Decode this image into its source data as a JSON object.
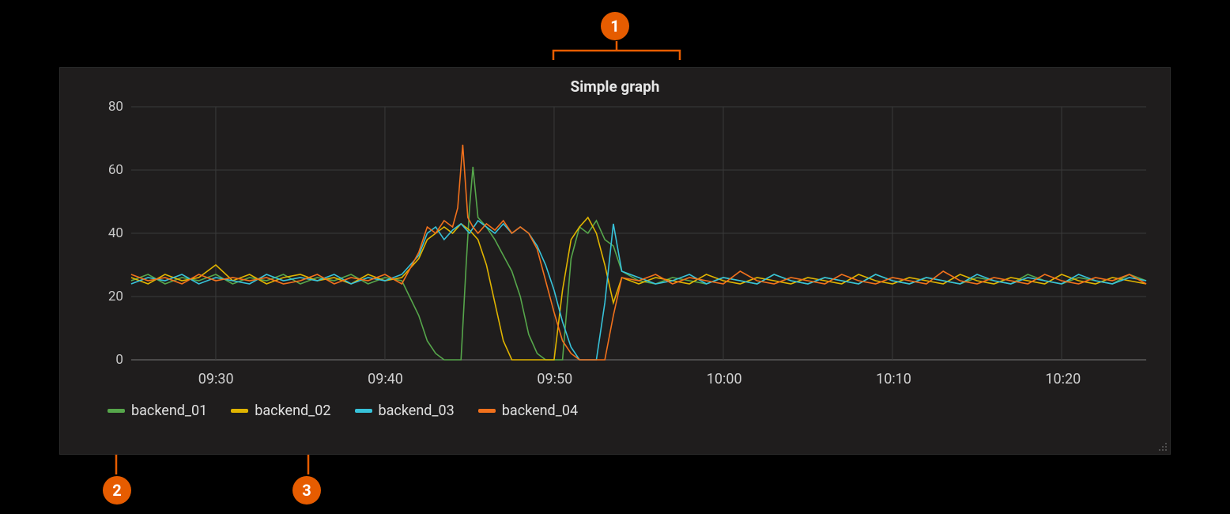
{
  "callouts": {
    "c1": "1",
    "c2": "2",
    "c3": "3"
  },
  "panel": {
    "title": "Simple graph"
  },
  "legend": [
    {
      "name": "backend_01",
      "color": "#56a64b"
    },
    {
      "name": "backend_02",
      "color": "#e0b400"
    },
    {
      "name": "backend_03",
      "color": "#37c2d9"
    },
    {
      "name": "backend_04",
      "color": "#f2711c"
    }
  ],
  "chart_data": {
    "type": "line",
    "title": "Simple graph",
    "xlabel": "",
    "ylabel": "",
    "ylim": [
      0,
      80
    ],
    "y_ticks": [
      0,
      20,
      40,
      60,
      80
    ],
    "x_ticks": [
      "09:30",
      "09:40",
      "09:50",
      "10:00",
      "10:10",
      "10:20"
    ],
    "x_range_minutes": [
      25,
      85
    ],
    "series": [
      {
        "name": "backend_01",
        "color": "#56a64b",
        "values": [
          [
            25,
            25
          ],
          [
            26,
            27
          ],
          [
            27,
            24
          ],
          [
            28,
            26
          ],
          [
            29,
            25
          ],
          [
            30,
            27
          ],
          [
            31,
            24
          ],
          [
            32,
            26
          ],
          [
            33,
            25
          ],
          [
            34,
            27
          ],
          [
            35,
            24
          ],
          [
            36,
            26
          ],
          [
            37,
            25
          ],
          [
            38,
            27
          ],
          [
            39,
            24
          ],
          [
            40,
            26
          ],
          [
            41,
            25
          ],
          [
            42,
            14
          ],
          [
            42.5,
            6
          ],
          [
            43,
            2
          ],
          [
            43.5,
            0
          ],
          [
            44,
            0
          ],
          [
            44.5,
            0
          ],
          [
            44.8,
            30
          ],
          [
            45,
            48
          ],
          [
            45.2,
            61
          ],
          [
            45.5,
            45
          ],
          [
            46,
            42
          ],
          [
            46.5,
            38
          ],
          [
            47,
            33
          ],
          [
            47.5,
            28
          ],
          [
            48,
            20
          ],
          [
            48.5,
            8
          ],
          [
            49,
            2
          ],
          [
            49.5,
            0
          ],
          [
            50,
            0
          ],
          [
            50.5,
            0
          ],
          [
            51,
            32
          ],
          [
            51.5,
            42
          ],
          [
            52,
            40
          ],
          [
            52.5,
            44
          ],
          [
            53,
            38
          ],
          [
            53.5,
            36
          ],
          [
            54,
            28
          ],
          [
            55,
            25
          ],
          [
            56,
            24
          ],
          [
            57,
            26
          ],
          [
            58,
            25
          ],
          [
            59,
            24
          ],
          [
            60,
            26
          ],
          [
            61,
            25
          ],
          [
            62,
            24
          ],
          [
            63,
            27
          ],
          [
            64,
            25
          ],
          [
            65,
            24
          ],
          [
            66,
            26
          ],
          [
            67,
            25
          ],
          [
            68,
            24
          ],
          [
            69,
            27
          ],
          [
            70,
            25
          ],
          [
            71,
            24
          ],
          [
            72,
            26
          ],
          [
            73,
            25
          ],
          [
            74,
            24
          ],
          [
            75,
            26
          ],
          [
            76,
            25
          ],
          [
            77,
            24
          ],
          [
            78,
            27
          ],
          [
            79,
            25
          ],
          [
            80,
            24
          ],
          [
            81,
            26
          ],
          [
            82,
            25
          ],
          [
            83,
            24
          ],
          [
            84,
            27
          ],
          [
            85,
            25
          ]
        ]
      },
      {
        "name": "backend_02",
        "color": "#e0b400",
        "values": [
          [
            25,
            26
          ],
          [
            26,
            24
          ],
          [
            27,
            27
          ],
          [
            28,
            25
          ],
          [
            29,
            26
          ],
          [
            30,
            30
          ],
          [
            31,
            25
          ],
          [
            32,
            27
          ],
          [
            33,
            24
          ],
          [
            34,
            26
          ],
          [
            35,
            27
          ],
          [
            36,
            25
          ],
          [
            37,
            26
          ],
          [
            38,
            24
          ],
          [
            39,
            27
          ],
          [
            40,
            25
          ],
          [
            41,
            26
          ],
          [
            42,
            32
          ],
          [
            42.5,
            38
          ],
          [
            43,
            40
          ],
          [
            43.5,
            42
          ],
          [
            44,
            40
          ],
          [
            44.5,
            43
          ],
          [
            45,
            41
          ],
          [
            45.5,
            38
          ],
          [
            46,
            30
          ],
          [
            46.5,
            18
          ],
          [
            47,
            6
          ],
          [
            47.5,
            0
          ],
          [
            48,
            0
          ],
          [
            48.5,
            0
          ],
          [
            49,
            0
          ],
          [
            49.5,
            0
          ],
          [
            50,
            0
          ],
          [
            50.5,
            22
          ],
          [
            51,
            38
          ],
          [
            51.5,
            42
          ],
          [
            52,
            45
          ],
          [
            52.5,
            40
          ],
          [
            53,
            30
          ],
          [
            53.5,
            18
          ],
          [
            54,
            26
          ],
          [
            55,
            24
          ],
          [
            56,
            26
          ],
          [
            57,
            25
          ],
          [
            58,
            24
          ],
          [
            59,
            27
          ],
          [
            60,
            25
          ],
          [
            61,
            24
          ],
          [
            62,
            26
          ],
          [
            63,
            25
          ],
          [
            64,
            24
          ],
          [
            65,
            26
          ],
          [
            66,
            25
          ],
          [
            67,
            24
          ],
          [
            68,
            27
          ],
          [
            69,
            25
          ],
          [
            70,
            24
          ],
          [
            71,
            26
          ],
          [
            72,
            25
          ],
          [
            73,
            24
          ],
          [
            74,
            27
          ],
          [
            75,
            25
          ],
          [
            76,
            24
          ],
          [
            77,
            26
          ],
          [
            78,
            25
          ],
          [
            79,
            24
          ],
          [
            80,
            27
          ],
          [
            81,
            25
          ],
          [
            82,
            24
          ],
          [
            83,
            26
          ],
          [
            84,
            25
          ],
          [
            85,
            24
          ]
        ]
      },
      {
        "name": "backend_03",
        "color": "#37c2d9",
        "values": [
          [
            25,
            24
          ],
          [
            26,
            26
          ],
          [
            27,
            25
          ],
          [
            28,
            27
          ],
          [
            29,
            24
          ],
          [
            30,
            26
          ],
          [
            31,
            25
          ],
          [
            32,
            24
          ],
          [
            33,
            27
          ],
          [
            34,
            25
          ],
          [
            35,
            26
          ],
          [
            36,
            25
          ],
          [
            37,
            27
          ],
          [
            38,
            24
          ],
          [
            39,
            26
          ],
          [
            40,
            25
          ],
          [
            41,
            27
          ],
          [
            42,
            33
          ],
          [
            42.5,
            40
          ],
          [
            43,
            42
          ],
          [
            43.5,
            38
          ],
          [
            44,
            41
          ],
          [
            44.5,
            43
          ],
          [
            45,
            40
          ],
          [
            45.5,
            44
          ],
          [
            46,
            42
          ],
          [
            46.5,
            40
          ],
          [
            47,
            43
          ],
          [
            47.5,
            40
          ],
          [
            48,
            42
          ],
          [
            48.5,
            40
          ],
          [
            49,
            36
          ],
          [
            49.5,
            30
          ],
          [
            50,
            22
          ],
          [
            50.5,
            12
          ],
          [
            51,
            4
          ],
          [
            51.5,
            0
          ],
          [
            52,
            0
          ],
          [
            52.5,
            0
          ],
          [
            53,
            18
          ],
          [
            53.5,
            43
          ],
          [
            54,
            28
          ],
          [
            55,
            26
          ],
          [
            56,
            24
          ],
          [
            57,
            25
          ],
          [
            58,
            27
          ],
          [
            59,
            24
          ],
          [
            60,
            26
          ],
          [
            61,
            25
          ],
          [
            62,
            24
          ],
          [
            63,
            27
          ],
          [
            64,
            25
          ],
          [
            65,
            24
          ],
          [
            66,
            26
          ],
          [
            67,
            25
          ],
          [
            68,
            24
          ],
          [
            69,
            27
          ],
          [
            70,
            25
          ],
          [
            71,
            24
          ],
          [
            72,
            26
          ],
          [
            73,
            25
          ],
          [
            74,
            24
          ],
          [
            75,
            27
          ],
          [
            76,
            25
          ],
          [
            77,
            24
          ],
          [
            78,
            26
          ],
          [
            79,
            25
          ],
          [
            80,
            24
          ],
          [
            81,
            27
          ],
          [
            82,
            25
          ],
          [
            83,
            24
          ],
          [
            84,
            26
          ],
          [
            85,
            25
          ]
        ]
      },
      {
        "name": "backend_04",
        "color": "#f2711c",
        "values": [
          [
            25,
            27
          ],
          [
            26,
            25
          ],
          [
            27,
            26
          ],
          [
            28,
            24
          ],
          [
            29,
            27
          ],
          [
            30,
            25
          ],
          [
            31,
            26
          ],
          [
            32,
            25
          ],
          [
            33,
            26
          ],
          [
            34,
            24
          ],
          [
            35,
            25
          ],
          [
            36,
            27
          ],
          [
            37,
            24
          ],
          [
            38,
            26
          ],
          [
            39,
            25
          ],
          [
            40,
            27
          ],
          [
            41,
            24
          ],
          [
            42,
            34
          ],
          [
            42.5,
            42
          ],
          [
            43,
            40
          ],
          [
            43.5,
            44
          ],
          [
            44,
            42
          ],
          [
            44.3,
            48
          ],
          [
            44.6,
            68
          ],
          [
            44.9,
            45
          ],
          [
            45.2,
            42
          ],
          [
            45.5,
            40
          ],
          [
            46,
            43
          ],
          [
            46.5,
            41
          ],
          [
            47,
            44
          ],
          [
            47.5,
            40
          ],
          [
            48,
            42
          ],
          [
            48.5,
            40
          ],
          [
            49,
            35
          ],
          [
            49.5,
            25
          ],
          [
            50,
            15
          ],
          [
            50.5,
            6
          ],
          [
            51,
            2
          ],
          [
            51.5,
            0
          ],
          [
            52,
            0
          ],
          [
            52.5,
            0
          ],
          [
            53,
            0
          ],
          [
            53.5,
            14
          ],
          [
            54,
            26
          ],
          [
            55,
            25
          ],
          [
            56,
            27
          ],
          [
            57,
            24
          ],
          [
            58,
            26
          ],
          [
            59,
            25
          ],
          [
            60,
            24
          ],
          [
            61,
            28
          ],
          [
            62,
            25
          ],
          [
            63,
            24
          ],
          [
            64,
            26
          ],
          [
            65,
            25
          ],
          [
            66,
            24
          ],
          [
            67,
            27
          ],
          [
            68,
            25
          ],
          [
            69,
            24
          ],
          [
            70,
            26
          ],
          [
            71,
            25
          ],
          [
            72,
            24
          ],
          [
            73,
            28
          ],
          [
            74,
            25
          ],
          [
            75,
            24
          ],
          [
            76,
            26
          ],
          [
            77,
            25
          ],
          [
            78,
            24
          ],
          [
            79,
            27
          ],
          [
            80,
            25
          ],
          [
            81,
            24
          ],
          [
            82,
            26
          ],
          [
            83,
            25
          ],
          [
            84,
            27
          ],
          [
            85,
            24
          ]
        ]
      }
    ]
  }
}
